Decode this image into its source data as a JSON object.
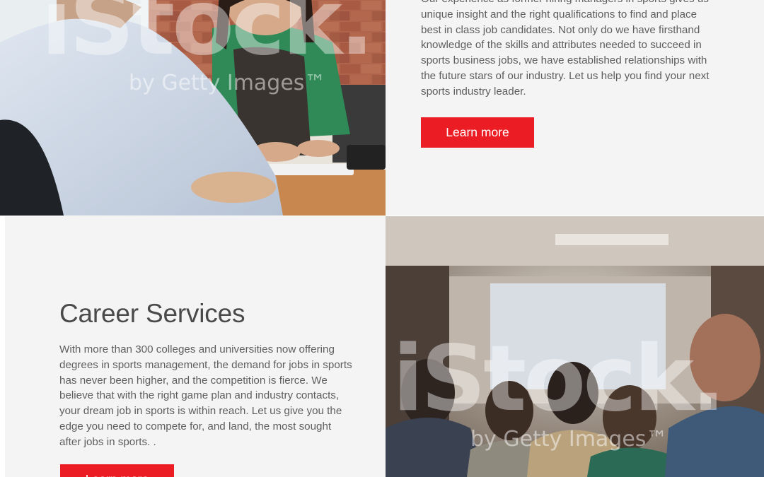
{
  "top_section": {
    "image": {
      "watermark_main": "iStock.",
      "watermark_sub": "by Getty Images™"
    },
    "body_text": "Our experience as former hiring managers in sports gives us unique insight and the right qualifications to find and place best in class job candidates. Not only do we have firsthand knowledge of the skills and attributes needed to succeed in sports business jobs, we have established relationships with the future stars of our industry. Let us help you find your next sports industry leader.",
    "button_label": "Learn more"
  },
  "career_section": {
    "title": "Career Services",
    "body_text": "With more than 300 colleges and universities now offering degrees in sports management, the demand for jobs in sports has never been higher, and the competition is fierce. We believe that with the right game plan and industry contacts, your dream job in sports is within reach. Let us give you the edge you need to compete for, and land, the most sought after jobs in sports. .",
    "button_label": "Learn more",
    "image": {
      "watermark_main": "iStock.",
      "watermark_sub": "by Getty Images™"
    }
  },
  "colors": {
    "accent": "#ec1c24",
    "panel_bg": "#f4f4f4",
    "text": "#5e5e5e"
  }
}
